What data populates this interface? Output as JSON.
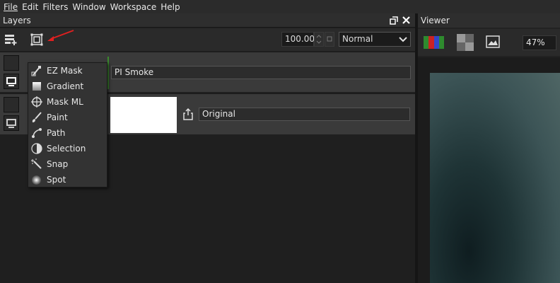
{
  "menu": [
    "File",
    "Edit",
    "Filters",
    "Window",
    "Workspace",
    "Help"
  ],
  "layers_panel": {
    "title": "Layers",
    "opacity": "100.00",
    "blend_mode": "Normal"
  },
  "layers": [
    {
      "name": "PI Smoke"
    },
    {
      "name": "Original"
    }
  ],
  "mask_menu": {
    "items": [
      {
        "label": "EZ Mask",
        "icon": "ez-mask-icon"
      },
      {
        "label": "Gradient",
        "icon": "gradient-icon"
      },
      {
        "label": "Mask ML",
        "icon": "mask-ml-icon"
      },
      {
        "label": "Paint",
        "icon": "paint-brush-icon"
      },
      {
        "label": "Path",
        "icon": "path-icon"
      },
      {
        "label": "Selection",
        "icon": "selection-icon"
      },
      {
        "label": "Snap",
        "icon": "snap-wand-icon"
      },
      {
        "label": "Spot",
        "icon": "spot-icon"
      }
    ]
  },
  "viewer": {
    "title": "Viewer",
    "zoom": "47%"
  },
  "colors": {
    "accent_arrow": "#e02020",
    "active_layer_marker": "#3b8a2e"
  }
}
